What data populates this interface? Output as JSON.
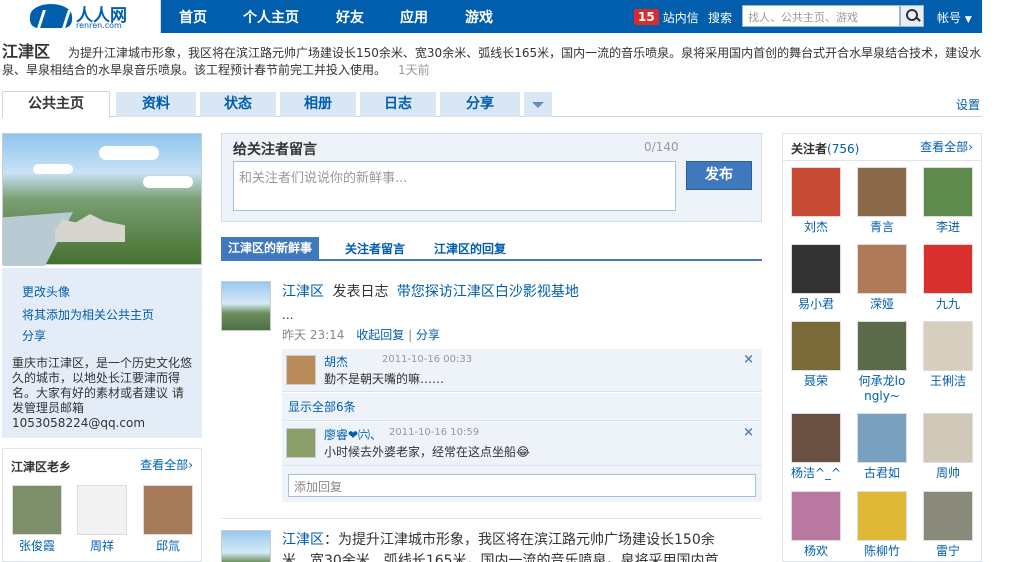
{
  "topbar": {
    "logo_text": "人人网",
    "logo_sub": "renren.com",
    "nav": [
      "首页",
      "个人主页",
      "好友",
      "应用",
      "游戏"
    ],
    "inbox_count": "15",
    "inbox_label": "站内信",
    "search_label": "搜索",
    "search_placeholder": "找人、公共主页、游戏",
    "account_label": "帐号"
  },
  "header": {
    "title": "江津区",
    "description": "为提升江津城市形象，我区将在滨江路元帅广场建设长150余米、宽30余米、弧线长165米，国内一流的音乐喷泉。泉将采用国内首创的舞台式开合水旱泉结合技术，建设水泉、旱泉相结合的水旱泉音乐喷泉。该工程预计春节前完工并投入使用。",
    "time": "1天前"
  },
  "tabs": [
    {
      "label": "公共主页"
    },
    {
      "label": "资料"
    },
    {
      "label": "状态"
    },
    {
      "label": "相册"
    },
    {
      "label": "日志"
    },
    {
      "label": "分享"
    }
  ],
  "settings_label": "设置",
  "left": {
    "links": [
      "更改头像",
      "将其添加为相关公共主页",
      "分享"
    ],
    "bio": "重庆市江津区，是一个历史文化悠久的城市，以地处长江要津而得名。大家有好的素材或者建议 请发管理员邮箱1053058224@qq.com"
  },
  "fellows": {
    "title": "江津区老乡",
    "view_all": "查看全部",
    "people": [
      {
        "name": "张俊霞",
        "color": "#7d8f6a"
      },
      {
        "name": "周祥",
        "color": "#3a3a3a"
      },
      {
        "name": "邱氚",
        "color": "#a57a5a"
      }
    ]
  },
  "message_box": {
    "title": "给关注者留言",
    "counter": "0/140",
    "placeholder": "和关注者们说说你的新鲜事...",
    "submit": "发布"
  },
  "feed_tabs": [
    "江津区的新鲜事",
    "关注者留言",
    "江津区的回复"
  ],
  "feed": {
    "item1": {
      "author": "江津区",
      "action": "发表日志",
      "link": "带您探访江津区白沙影视基地",
      "ellipsis": "...",
      "time": "昨天  23:14",
      "collapse": "收起回复",
      "divider": "|",
      "share": "分享"
    },
    "comments": [
      {
        "name": "胡杰",
        "date": "2011-10-16 00:33",
        "text": "勤不是朝天嘴的嘛……",
        "close": "×",
        "avatar_color": "#b98a5a"
      },
      {
        "name": "廖睿❤㈥、",
        "date": "2011-10-16 10:59",
        "text": "小时候去外婆老家，经常在这点坐船",
        "emoji": "😂",
        "close": "×",
        "avatar_color": "#8a9e6a"
      }
    ],
    "show_all": "显示全部6条",
    "reply_placeholder": "添加回复",
    "item2": {
      "author": "江津区",
      "text_line1": "：为提升江津城市形象，我区将在滨江路元帅广场建设长150余",
      "text_line2": "米、宽30余米、弧线长165米，国内一流的音乐喷泉。泉将采用国内首"
    }
  },
  "followers": {
    "title": "关注者",
    "count": "(756)",
    "view_all": "查看全部",
    "people": [
      {
        "name": "刘杰",
        "color": "#c74b34"
      },
      {
        "name": "青言",
        "color": "#8b6a4a"
      },
      {
        "name": "李进",
        "color": "#5e8a4e"
      },
      {
        "name": "易小君",
        "color": "#333333"
      },
      {
        "name": "溁娅",
        "color": "#b07a5a"
      },
      {
        "name": "九九",
        "color": "#d8302c"
      },
      {
        "name": "聂荣",
        "color": "#7a6a3a"
      },
      {
        "name": "何承龙lo ngly~",
        "color": "#5a6a4a"
      },
      {
        "name": "王俐洁",
        "color": "#d6cfc0"
      },
      {
        "name": "杨洁^_^",
        "color": "#6a5040"
      },
      {
        "name": "古君如",
        "color": "#7aa0c0"
      },
      {
        "name": "周帅",
        "color": "#d0c8b8"
      },
      {
        "name": "杨欢",
        "color": "#b878a0"
      },
      {
        "name": "陈柳竹",
        "color": "#e0b838"
      },
      {
        "name": "雷宁",
        "color": "#8a8a7a"
      }
    ]
  }
}
